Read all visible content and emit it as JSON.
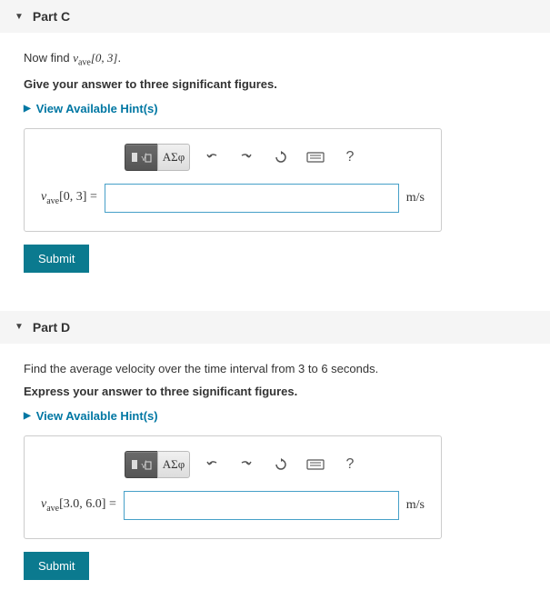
{
  "parts": [
    {
      "header": "Part C",
      "prompt_prefix": "Now find ",
      "prompt_var": "v",
      "prompt_sub": "ave",
      "prompt_interval": "[0, 3]",
      "prompt_suffix": ".",
      "instruction": "Give your answer to three significant figures.",
      "hints_label": "View Available Hint(s)",
      "lhs_var": "v",
      "lhs_sub": "ave",
      "lhs_interval": "[0, 3]",
      "equals": " = ",
      "unit": "m/s",
      "submit": "Submit",
      "toolbar": {
        "greek": "ΑΣφ",
        "help": "?"
      }
    },
    {
      "header": "Part D",
      "prompt_plain": "Find the average velocity over the time interval from 3 to 6 seconds.",
      "instruction": "Express your answer to three significant figures.",
      "hints_label": "View Available Hint(s)",
      "lhs_var": "v",
      "lhs_sub": "ave",
      "lhs_interval": "[3.0, 6.0]",
      "equals": " = ",
      "unit": "m/s",
      "submit": "Submit",
      "toolbar": {
        "greek": "ΑΣφ",
        "help": "?"
      }
    }
  ]
}
